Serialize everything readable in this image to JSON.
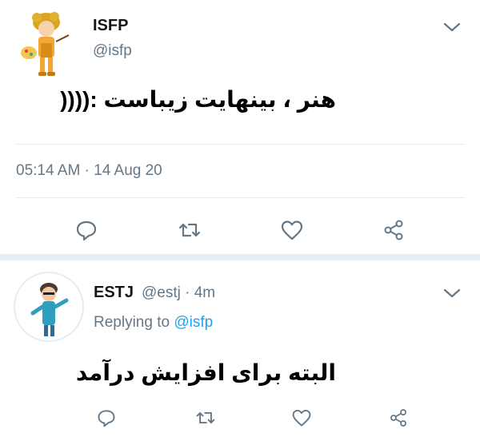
{
  "tweet": {
    "name": "ISFP",
    "handle": "@isfp",
    "text": "هنر ، بینهایت زیباست :((((",
    "timestamp": "05:14 AM · 14 Aug 20"
  },
  "reply": {
    "name": "ESTJ",
    "handle_time": "@estj · 4m",
    "replying_prefix": "Replying to",
    "replying_handle": "@isfp",
    "text": "البته برای افزایش درآمد"
  },
  "icons": [
    "reply-icon",
    "retweet-icon",
    "like-icon",
    "share-icon",
    "chevron-down-icon"
  ],
  "colors": {
    "icon_gray": "#657786",
    "mention_blue": "#1da1f2",
    "divider": "#e6ecf0"
  }
}
